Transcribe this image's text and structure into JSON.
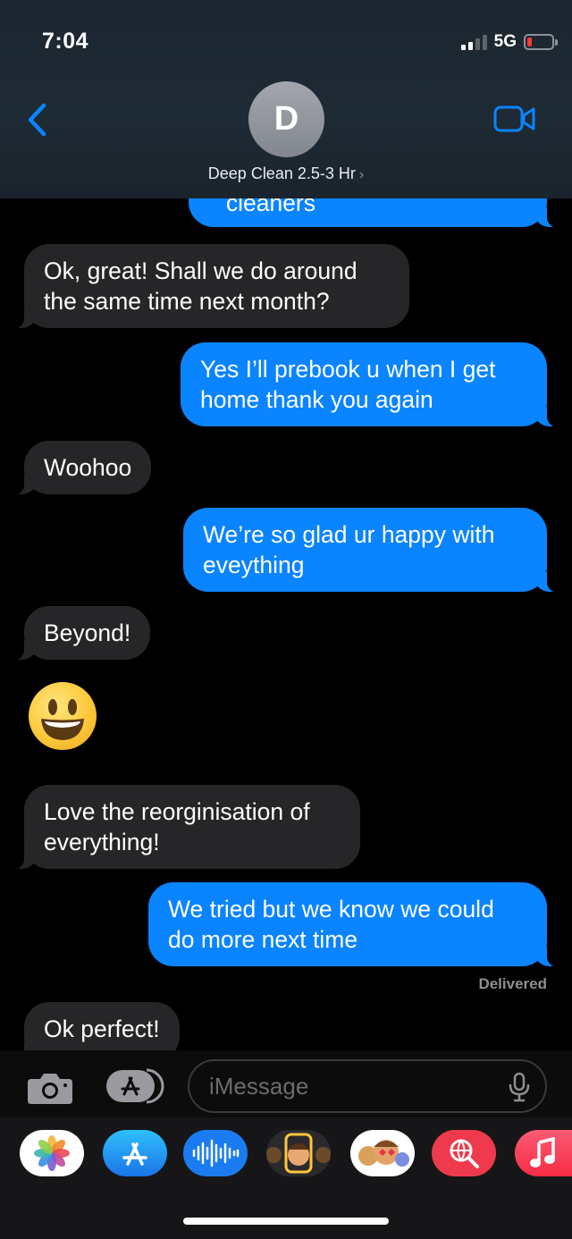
{
  "status_bar": {
    "time": "7:04",
    "network": "5G",
    "signal_bars_filled": 2,
    "signal_bars_total": 4,
    "battery_level": "low"
  },
  "header": {
    "avatar_initial": "D",
    "contact_name": "Deep Clean 2.5-3 Hr",
    "contact_chevron": "›",
    "back_icon": "chevron-left-icon",
    "video_icon": "video-camera-icon"
  },
  "messages": [
    {
      "direction": "out",
      "lines": [
        "cleaners"
      ],
      "partially_hidden": true
    },
    {
      "direction": "in",
      "lines": [
        "Ok, great! Shall we do around",
        "the same time next month?"
      ]
    },
    {
      "direction": "out",
      "lines": [
        "Yes I’ll prebook u when I get",
        "home thank you again"
      ]
    },
    {
      "direction": "in",
      "lines": [
        "Woohoo"
      ]
    },
    {
      "direction": "out",
      "lines": [
        "We’re so glad ur happy with",
        "eveything"
      ]
    },
    {
      "direction": "in",
      "lines": [
        "Beyond!"
      ]
    },
    {
      "direction": "in",
      "type": "emoji",
      "emoji": "smiling-face-icon"
    },
    {
      "direction": "in",
      "lines": [
        "Love the reorginisation of",
        "everything!"
      ]
    },
    {
      "direction": "out",
      "lines": [
        "We tried but we know we could",
        "do more next time"
      ]
    },
    {
      "direction": "in",
      "lines": [
        "Ok perfect!"
      ],
      "partially_hidden": true
    }
  ],
  "delivery_status": "Delivered",
  "input_bar": {
    "placeholder": "iMessage",
    "camera_icon": "camera-icon",
    "apps_icon": "app-store-icon",
    "mic_icon": "microphone-icon"
  },
  "app_drawer": [
    {
      "name": "photos-app-icon"
    },
    {
      "name": "app-store-app-icon"
    },
    {
      "name": "audio-message-app-icon"
    },
    {
      "name": "memoji-app-icon"
    },
    {
      "name": "memoji-stickers-app-icon"
    },
    {
      "name": "web-images-search-app-icon"
    },
    {
      "name": "music-app-icon"
    }
  ],
  "colors": {
    "outgoing_bubble": "#0a84ff",
    "incoming_bubble": "#262628",
    "accent": "#0a84ff",
    "background": "#000000"
  }
}
